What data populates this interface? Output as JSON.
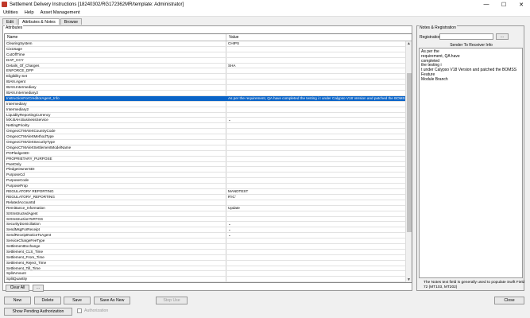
{
  "window": {
    "title": "Settlement Delivery Instructions  [18240302/RG172362MR/template: Administrator]",
    "controls": {
      "minimize": "—",
      "maximize": "☐",
      "close": "✕"
    }
  },
  "menu": [
    "Utilities",
    "Help",
    "Asset Management"
  ],
  "tabs": [
    "Edit",
    "Attributes & Notes",
    "Browse"
  ],
  "attributes": {
    "legend": "Attributes",
    "headers": {
      "name": "Name",
      "value": "Value"
    },
    "rows": [
      {
        "name": "ClearingSystem",
        "value": "CHIPS"
      },
      {
        "name": "CixUsage",
        "value": ""
      },
      {
        "name": "CutOffTime",
        "value": ""
      },
      {
        "name": "DAP_CCY",
        "value": ""
      },
      {
        "name": "Details_Of_Charges",
        "value": "SHA"
      },
      {
        "name": "ENFORCE_DFP",
        "value": ""
      },
      {
        "name": "Eligibility Set",
        "value": ""
      },
      {
        "name": "IBAN.Agent",
        "value": ""
      },
      {
        "name": "IBAN.Intermediary",
        "value": ""
      },
      {
        "name": "IBAN.Intermediary2",
        "value": ""
      },
      {
        "name": "InstructionForCreditorAgent_Info",
        "value": "As per the requirement, QA have completed the testing i.t under Calypso V18 Version and patched the BOMSS",
        "selected": true
      },
      {
        "name": "Intermediary",
        "value": ""
      },
      {
        "name": "Intermediary2",
        "value": ""
      },
      {
        "name": "LiquidityReportingCurrency",
        "value": ""
      },
      {
        "name": "MX.BAH.BusinessService",
        "value": "⌄"
      },
      {
        "name": "NettingPriority",
        "value": ""
      },
      {
        "name": "OmgeoCTMAlertCountryCode",
        "value": ""
      },
      {
        "name": "OmgeoCTMAlertMethodType",
        "value": ""
      },
      {
        "name": "OmgeoCTMAlertSecurityType",
        "value": ""
      },
      {
        "name": "OmgeoCTMAlertSettlementModelName",
        "value": ""
      },
      {
        "name": "POPledgeSDI",
        "value": ""
      },
      {
        "name": "PROPRIETARY_PURPOSE",
        "value": ""
      },
      {
        "name": "PsetOnly",
        "value": ""
      },
      {
        "name": "PledgeOwnerSDI",
        "value": ""
      },
      {
        "name": "PurposeCd",
        "value": ""
      },
      {
        "name": "PurposeCode",
        "value": ""
      },
      {
        "name": "PurposeProp",
        "value": ""
      },
      {
        "name": "REGULATORY REPORTING",
        "value": "MANDTEST"
      },
      {
        "name": "REGULATORY_REPORTING",
        "value": "R'IC'"
      },
      {
        "name": "RelatedAccountId",
        "value": ""
      },
      {
        "name": "Remittance_Information",
        "value": "Update"
      },
      {
        "name": "SIXInstructedAgent",
        "value": ""
      },
      {
        "name": "SIXInstructionToRTGS",
        "value": ""
      },
      {
        "name": "SecurityDomiciliation",
        "value": "⌄"
      },
      {
        "name": "SendMsgForReceipt",
        "value": "⌄"
      },
      {
        "name": "SendReceiptNoticeToAgent",
        "value": "⌄"
      },
      {
        "name": "ServiceChargeFeeType",
        "value": ""
      },
      {
        "name": "SettlementExchange",
        "value": ""
      },
      {
        "name": "Settlement_CLS_Time",
        "value": ""
      },
      {
        "name": "Settlement_From_Time",
        "value": ""
      },
      {
        "name": "Settlement_Reject_Time",
        "value": ""
      },
      {
        "name": "Settlement_Till_Time",
        "value": ""
      },
      {
        "name": "SplitAmount",
        "value": ""
      },
      {
        "name": "SplitQuantity",
        "value": ""
      }
    ],
    "scroll": {
      "up": "▲",
      "down": "▼"
    },
    "buttons": {
      "clear_all": "Clear All",
      "more": "..."
    }
  },
  "notes": {
    "legend": "Notes & Registration",
    "registration_label": "Registration",
    "registration_value": "",
    "registration_button": "...",
    "sender_label": "Sender To Receiver Info",
    "text": "As per the\nrequirement, QA have\ncompleted\nthe testing i\nt under Calypso V18 Version and patched the BOMSS Feature\nModule Branch",
    "help": "The Notes text field is generally used to populate Swift Field 72 (MT103, MT202)"
  },
  "bottom": {
    "new": "New",
    "delete": "Delete",
    "save": "Save",
    "save_as_new": "Save As New",
    "stop": "Stop Use",
    "close": "Close",
    "pending": "Show Pending Authorization",
    "authorization": "Authorization"
  }
}
